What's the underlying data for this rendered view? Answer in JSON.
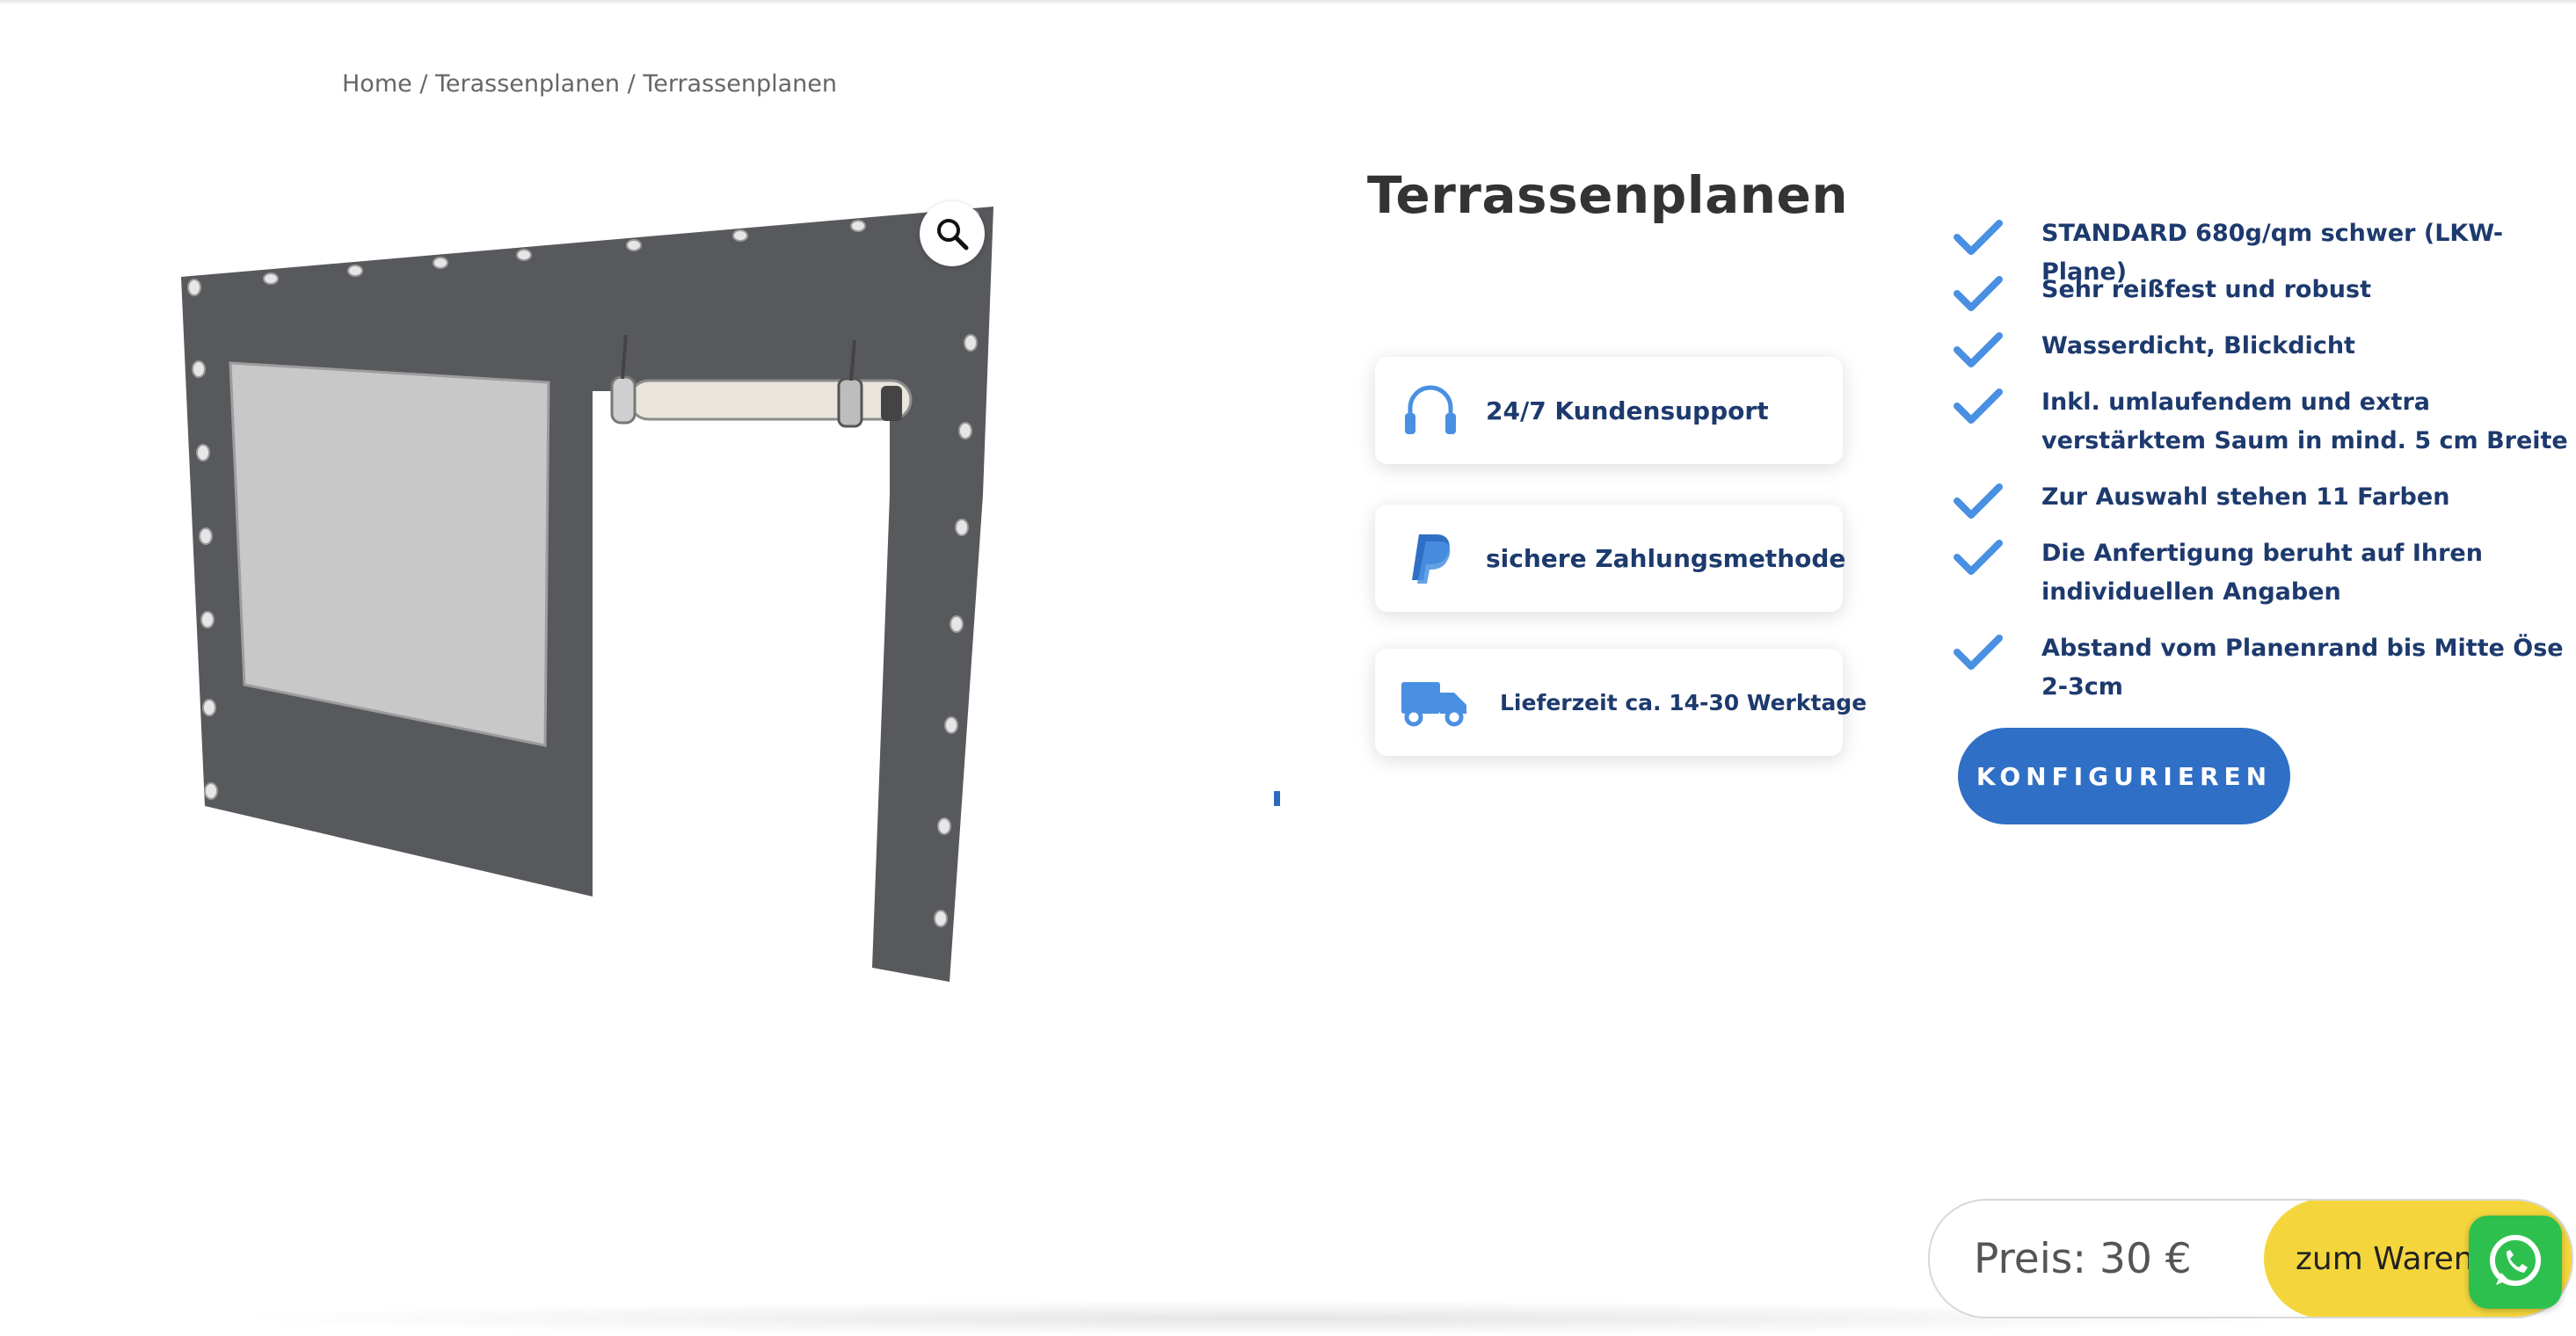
{
  "breadcrumb": {
    "items": [
      "Home",
      "Terassenplanen",
      "Terrassenplanen"
    ],
    "separator": " / "
  },
  "product": {
    "title": "Terrassenplanen",
    "image_icon": "product-photo-tarp-with-roller",
    "zoom_icon": "magnifier-icon"
  },
  "badges": [
    {
      "icon": "headset-icon",
      "label": "24/7 Kundensupport"
    },
    {
      "icon": "paypal-icon",
      "label": "sichere Zahlungsmethode"
    },
    {
      "icon": "truck-icon",
      "label": "Lieferzeit ca. 14-30 Werktage"
    }
  ],
  "features": [
    "STANDARD 680g/qm schwer (LKW-Plane)",
    "Sehr reißfest und robust",
    "Wasserdicht, Blickdicht",
    "Inkl. umlaufendem und extra verstärktem Saum in mind. 5 cm Breite",
    "Zur Auswahl stehen 11 Farben",
    "Die Anfertigung beruht auf Ihren individuellen Angaben",
    "Abstand vom Planenrand bis Mitte Öse 2-3cm"
  ],
  "configure_button": "KONFIGURIEREN",
  "price_bar": {
    "price": "Preis: 30 €",
    "cart_button": "zum Warenkorb"
  },
  "colors": {
    "accent_blue": "#2f6fc5",
    "text_navy": "#1d3a6e",
    "check_blue": "#4a90e2",
    "cart_yellow": "#f4d63c",
    "whatsapp_green": "#2ec04f"
  }
}
